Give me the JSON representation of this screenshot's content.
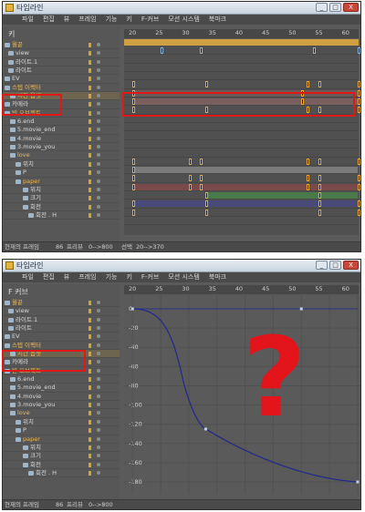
{
  "window_title": "타임라인",
  "title_buttons": [
    "_",
    "□",
    "X"
  ],
  "menu": [
    "파일",
    "편집",
    "뷰",
    "프레임",
    "기능",
    "키",
    "F-커브",
    "모션 시스템",
    "북마크"
  ],
  "top": {
    "mode_label": "키",
    "ruler_ticks": [
      "20",
      "25",
      "30",
      "35",
      "40",
      "45",
      "50",
      "55",
      "60"
    ],
    "layers": [
      {
        "label": "월끝",
        "indent": 10,
        "hl": true
      },
      {
        "label": "view",
        "indent": 14
      },
      {
        "label": "라이트.1",
        "indent": 14
      },
      {
        "label": "라이트",
        "indent": 14
      },
      {
        "label": "EV",
        "indent": 10
      },
      {
        "label": "스텝 이펙터",
        "indent": 10,
        "hl": true
      },
      {
        "label": "시간 옵셋",
        "indent": 16,
        "hl": true,
        "sel": true
      },
      {
        "label": "카메라",
        "indent": 10
      },
      {
        "label": "빈 오브젝트",
        "indent": 10,
        "hl": true
      },
      {
        "label": "6.end",
        "indent": 16
      },
      {
        "label": "5.movie_end",
        "indent": 16
      },
      {
        "label": "4.movie",
        "indent": 16
      },
      {
        "label": "3.movie_you",
        "indent": 16
      },
      {
        "label": "love",
        "indent": 16,
        "hl": true
      },
      {
        "label": "위치",
        "indent": 22
      },
      {
        "label": "P",
        "indent": 22
      },
      {
        "label": "paper",
        "indent": 22,
        "hl": true
      },
      {
        "label": "위치",
        "indent": 30
      },
      {
        "label": "크기",
        "indent": 30
      },
      {
        "label": "회전",
        "indent": 30
      },
      {
        "label": "회전 . H",
        "indent": 36
      }
    ],
    "status": {
      "current_frame_label": "현재의 프레임",
      "current_frame": "86",
      "preview_label": "프리뷰",
      "preview_range": "0-->800",
      "selection_label": "선택",
      "selection_range": "20-->370"
    }
  },
  "bottom": {
    "mode_label": "F 커브",
    "ruler_ticks": [
      "20",
      "25",
      "30",
      "35",
      "40",
      "45",
      "50",
      "55",
      "60"
    ],
    "y_axis_ticks": [
      "0",
      "-20",
      "-40",
      "-60",
      "-80",
      "-100",
      "-120",
      "-140",
      "-160",
      "-180"
    ],
    "layers": [
      {
        "label": "월끝",
        "indent": 10,
        "hl": true
      },
      {
        "label": "view",
        "indent": 14
      },
      {
        "label": "라이트.1",
        "indent": 14
      },
      {
        "label": "라이트",
        "indent": 14
      },
      {
        "label": "EV",
        "indent": 10
      },
      {
        "label": "스텝 이펙터",
        "indent": 10,
        "hl": true
      },
      {
        "label": "시간 옵셋",
        "indent": 16,
        "hl": true,
        "sel": true
      },
      {
        "label": "카메라",
        "indent": 10
      },
      {
        "label": "빈 오브젝트",
        "indent": 10,
        "hl": true
      },
      {
        "label": "6.end",
        "indent": 16
      },
      {
        "label": "5.movie_end",
        "indent": 16
      },
      {
        "label": "4.movie",
        "indent": 16
      },
      {
        "label": "3.movie_you",
        "indent": 16
      },
      {
        "label": "love",
        "indent": 16,
        "hl": true
      },
      {
        "label": "위치",
        "indent": 22
      },
      {
        "label": "P",
        "indent": 22
      },
      {
        "label": "paper",
        "indent": 22,
        "hl": true
      },
      {
        "label": "위치",
        "indent": 30
      },
      {
        "label": "크기",
        "indent": 30
      },
      {
        "label": "회전",
        "indent": 30
      },
      {
        "label": "회전 . H",
        "indent": 36
      }
    ],
    "status": {
      "current_frame_label": "현재의 프레임",
      "current_frame": "86",
      "preview_label": "프리뷰",
      "preview_range": "0-->800"
    },
    "annotation": "?"
  },
  "colors": {
    "accent": "#e0a030",
    "highlight_box": "#e01818",
    "curve": "#1f2a8c"
  }
}
